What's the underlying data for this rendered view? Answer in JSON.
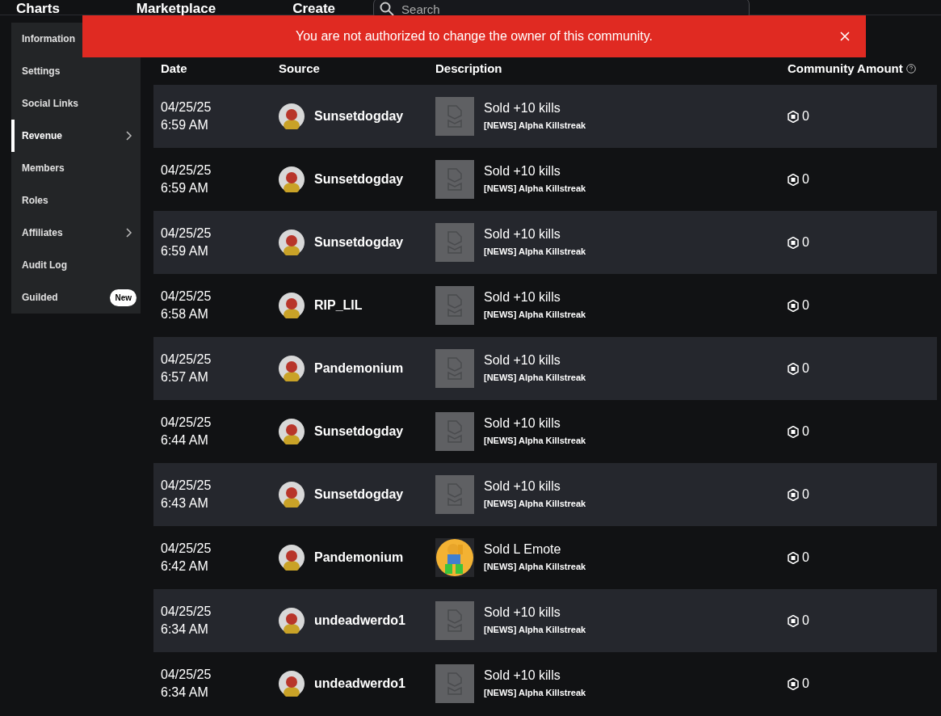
{
  "top_nav": {
    "links": [
      "Charts",
      "Marketplace",
      "Create"
    ],
    "search": {
      "placeholder": "Search"
    }
  },
  "sidebar": {
    "items": [
      {
        "label": "Information",
        "selected": false,
        "has_submenu": false
      },
      {
        "label": "Settings",
        "selected": false,
        "has_submenu": false
      },
      {
        "label": "Social Links",
        "selected": false,
        "has_submenu": false
      },
      {
        "label": "Revenue",
        "selected": true,
        "has_submenu": true
      },
      {
        "label": "Members",
        "selected": false,
        "has_submenu": false
      },
      {
        "label": "Roles",
        "selected": false,
        "has_submenu": false
      },
      {
        "label": "Affiliates",
        "selected": false,
        "has_submenu": true
      },
      {
        "label": "Audit Log",
        "selected": false,
        "has_submenu": false
      },
      {
        "label": "Guilded",
        "selected": false,
        "has_submenu": false,
        "badge": "New"
      }
    ]
  },
  "alert": {
    "message": "You are not authorized to change the owner of this community."
  },
  "table": {
    "columns": [
      "Date",
      "Source",
      "Description",
      "Community Amount"
    ],
    "rows": [
      {
        "date": "04/25/25",
        "time": "6:59 AM",
        "source": "Sunsetdogday",
        "thumbnail": {
          "kind": "placeholder"
        },
        "title": "Sold +10 kills",
        "subtitle": "[NEWS] Alpha Killstreak",
        "amount": "0"
      },
      {
        "date": "04/25/25",
        "time": "6:59 AM",
        "source": "Sunsetdogday",
        "thumbnail": {
          "kind": "placeholder"
        },
        "title": "Sold +10 kills",
        "subtitle": "[NEWS] Alpha Killstreak",
        "amount": "0"
      },
      {
        "date": "04/25/25",
        "time": "6:59 AM",
        "source": "Sunsetdogday",
        "thumbnail": {
          "kind": "placeholder"
        },
        "title": "Sold +10 kills",
        "subtitle": "[NEWS] Alpha Killstreak",
        "amount": "0"
      },
      {
        "date": "04/25/25",
        "time": "6:58 AM",
        "source": "RIP_LIL",
        "thumbnail": {
          "kind": "placeholder"
        },
        "title": "Sold +10 kills",
        "subtitle": "[NEWS] Alpha Killstreak",
        "amount": "0"
      },
      {
        "date": "04/25/25",
        "time": "6:57 AM",
        "source": "Pandemonium",
        "thumbnail": {
          "kind": "placeholder"
        },
        "title": "Sold +10 kills",
        "subtitle": "[NEWS] Alpha Killstreak",
        "amount": "0"
      },
      {
        "date": "04/25/25",
        "time": "6:44 AM",
        "source": "Sunsetdogday",
        "thumbnail": {
          "kind": "placeholder"
        },
        "title": "Sold +10 kills",
        "subtitle": "[NEWS] Alpha Killstreak",
        "amount": "0"
      },
      {
        "date": "04/25/25",
        "time": "6:43 AM",
        "source": "Sunsetdogday",
        "thumbnail": {
          "kind": "placeholder"
        },
        "title": "Sold +10 kills",
        "subtitle": "[NEWS] Alpha Killstreak",
        "amount": "0"
      },
      {
        "date": "04/25/25",
        "time": "6:42 AM",
        "source": "Pandemonium",
        "title": "Sold L Emote",
        "subtitle": "[NEWS] Alpha Killstreak",
        "amount": "0"
      },
      {
        "date": "04/25/25",
        "time": "6:34 AM",
        "source": "undeadwerdo1",
        "thumbnail": {
          "kind": "placeholder"
        },
        "title": "Sold +10 kills",
        "subtitle": "[NEWS] Alpha Killstreak",
        "amount": "0"
      },
      {
        "date": "04/25/25",
        "time": "6:34 AM",
        "source": "undeadwerdo1",
        "thumbnail": {
          "kind": "placeholder"
        },
        "title": "Sold +10 kills",
        "subtitle": "[NEWS] Alpha Killstreak",
        "amount": "0"
      }
    ]
  }
}
